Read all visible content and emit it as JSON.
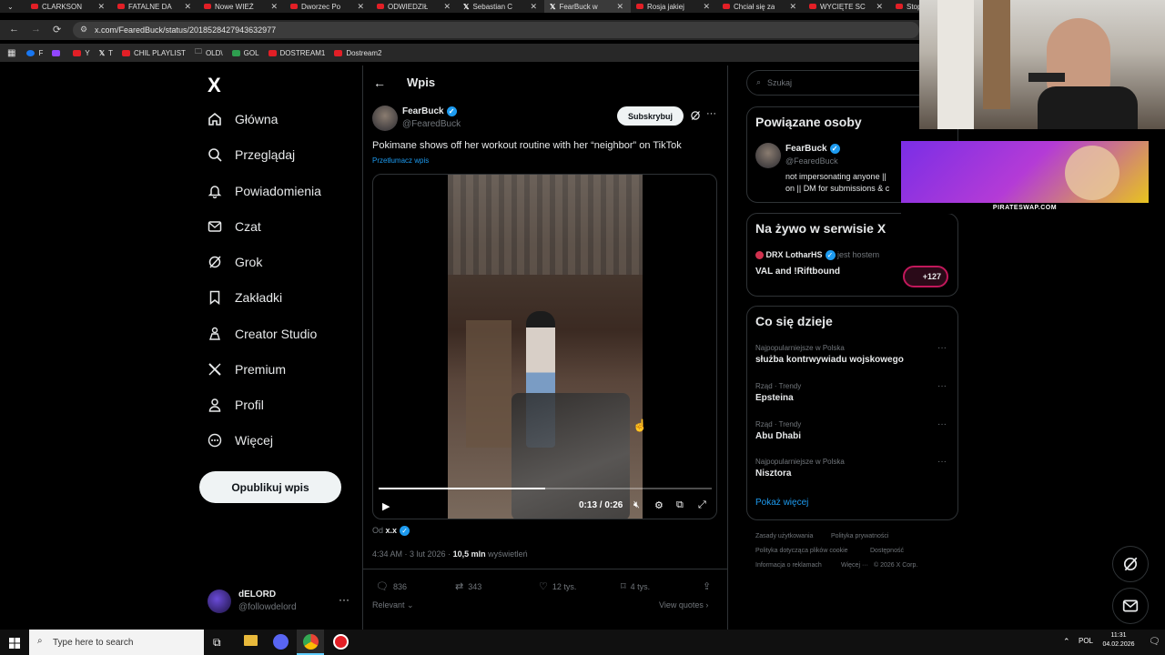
{
  "browser": {
    "tabs": [
      {
        "title": "CLARKSON",
        "icon": "youtube-icon",
        "active": false
      },
      {
        "title": "FATALNE DA",
        "icon": "youtube-icon",
        "active": false
      },
      {
        "title": "Nowe WIEŻ",
        "icon": "youtube-icon",
        "active": false
      },
      {
        "title": "Dworzec Po",
        "icon": "youtube-icon",
        "active": false
      },
      {
        "title": "ODWIEDZIŁ",
        "icon": "youtube-icon",
        "active": false
      },
      {
        "title": "Sebastian C",
        "icon": "x-icon",
        "active": false
      },
      {
        "title": "FearBuck w",
        "icon": "x-icon",
        "active": true
      },
      {
        "title": "Rosja jakiej",
        "icon": "youtube-icon",
        "active": false
      },
      {
        "title": "Chciał się za",
        "icon": "youtube-icon",
        "active": false
      },
      {
        "title": "WYCIĘTE SC",
        "icon": "youtube-icon",
        "active": false
      },
      {
        "title": "Stop Chan",
        "icon": "youtube-icon",
        "active": false
      }
    ],
    "url": "x.com/FearedBuck/status/2018528427943632977",
    "bookmarks": [
      "F",
      "",
      "Y",
      "T",
      "CHIL PLAYLIST",
      "OLD\\",
      "GOL",
      "DOSTREAM1",
      "Dostream2"
    ]
  },
  "nav": {
    "logo": "X",
    "items": [
      {
        "label": "Główna",
        "icon": "home-icon"
      },
      {
        "label": "Przeglądaj",
        "icon": "search-icon"
      },
      {
        "label": "Powiadomienia",
        "icon": "bell-icon"
      },
      {
        "label": "Czat",
        "icon": "mail-icon"
      },
      {
        "label": "Grok",
        "icon": "grok-icon"
      },
      {
        "label": "Zakładki",
        "icon": "bookmark-icon"
      },
      {
        "label": "Creator Studio",
        "icon": "creator-icon"
      },
      {
        "label": "Premium",
        "icon": "x-icon"
      },
      {
        "label": "Profil",
        "icon": "person-icon"
      },
      {
        "label": "Więcej",
        "icon": "more-circle-icon"
      }
    ],
    "publish_label": "Opublikuj wpis",
    "account": {
      "name": "dELORD",
      "handle": "@followdelord"
    }
  },
  "post": {
    "header_title": "Wpis",
    "author_name": "FearBuck",
    "author_handle": "@FearedBuck",
    "subscribe_label": "Subskrybuj",
    "text": "Pokimane shows off her workout routine with her “neighbor” on TikTok",
    "translate_label": "Przetłumacz wpis",
    "video": {
      "time": "0:13 / 0:26",
      "progress": 0.5
    },
    "source_prefix": "Od",
    "source_name": "x.x",
    "timestamp": "4:34 AM · 3 lut 2026 ·",
    "views_count": "10,5 mln",
    "views_label": "wyświetleń",
    "stats": {
      "replies": "836",
      "reposts": "343",
      "likes": "12 tys.",
      "bookmarks": "4 tys."
    },
    "sort_label": "Relevant",
    "quotes_label": "View quotes"
  },
  "right": {
    "search_placeholder": "Szukaj",
    "related": {
      "title": "Powiązane osoby",
      "name": "FearBuck",
      "handle": "@FearedBuck",
      "bio_line1": "not impersonating anyone ||",
      "bio_line2": "on || DM for submissions & c"
    },
    "live": {
      "title": "Na żywo w serwisie X",
      "host_name": "DRX LotharHS",
      "host_suffix": "jest hostem",
      "space_title": "VAL and !Riftbound",
      "listeners": "+127"
    },
    "trends": {
      "title": "Co się dzieje",
      "items": [
        {
          "meta": "Najpopularniejsze w Polska",
          "name": "służba kontrwywiadu wojskowego"
        },
        {
          "meta": "Rząd · Trendy",
          "name": "Epsteina"
        },
        {
          "meta": "Rząd · Trendy",
          "name": "Abu Dhabi"
        },
        {
          "meta": "Najpopularniejsze w Polska",
          "name": "Nisztora"
        }
      ],
      "show_more": "Pokaż więcej"
    },
    "footer": [
      "Zasady użytkowania",
      "Polityka prywatności",
      "Polityka dotycząca plików cookie",
      "Dostępność",
      "Informacja o reklamach",
      "Więcej ···",
      "© 2026 X Corp."
    ]
  },
  "overlay": {
    "ad_caption": "PIRATESWAP.COM"
  },
  "taskbar": {
    "search_placeholder": "Type here to search",
    "lang": "POL",
    "time": "11:31",
    "date": "04.02.2026"
  },
  "colors": {
    "accent": "#1d9bf0",
    "text": "#e7e9ea",
    "muted": "#71767b",
    "border": "#2f3336",
    "youtube": "#e21f26"
  }
}
